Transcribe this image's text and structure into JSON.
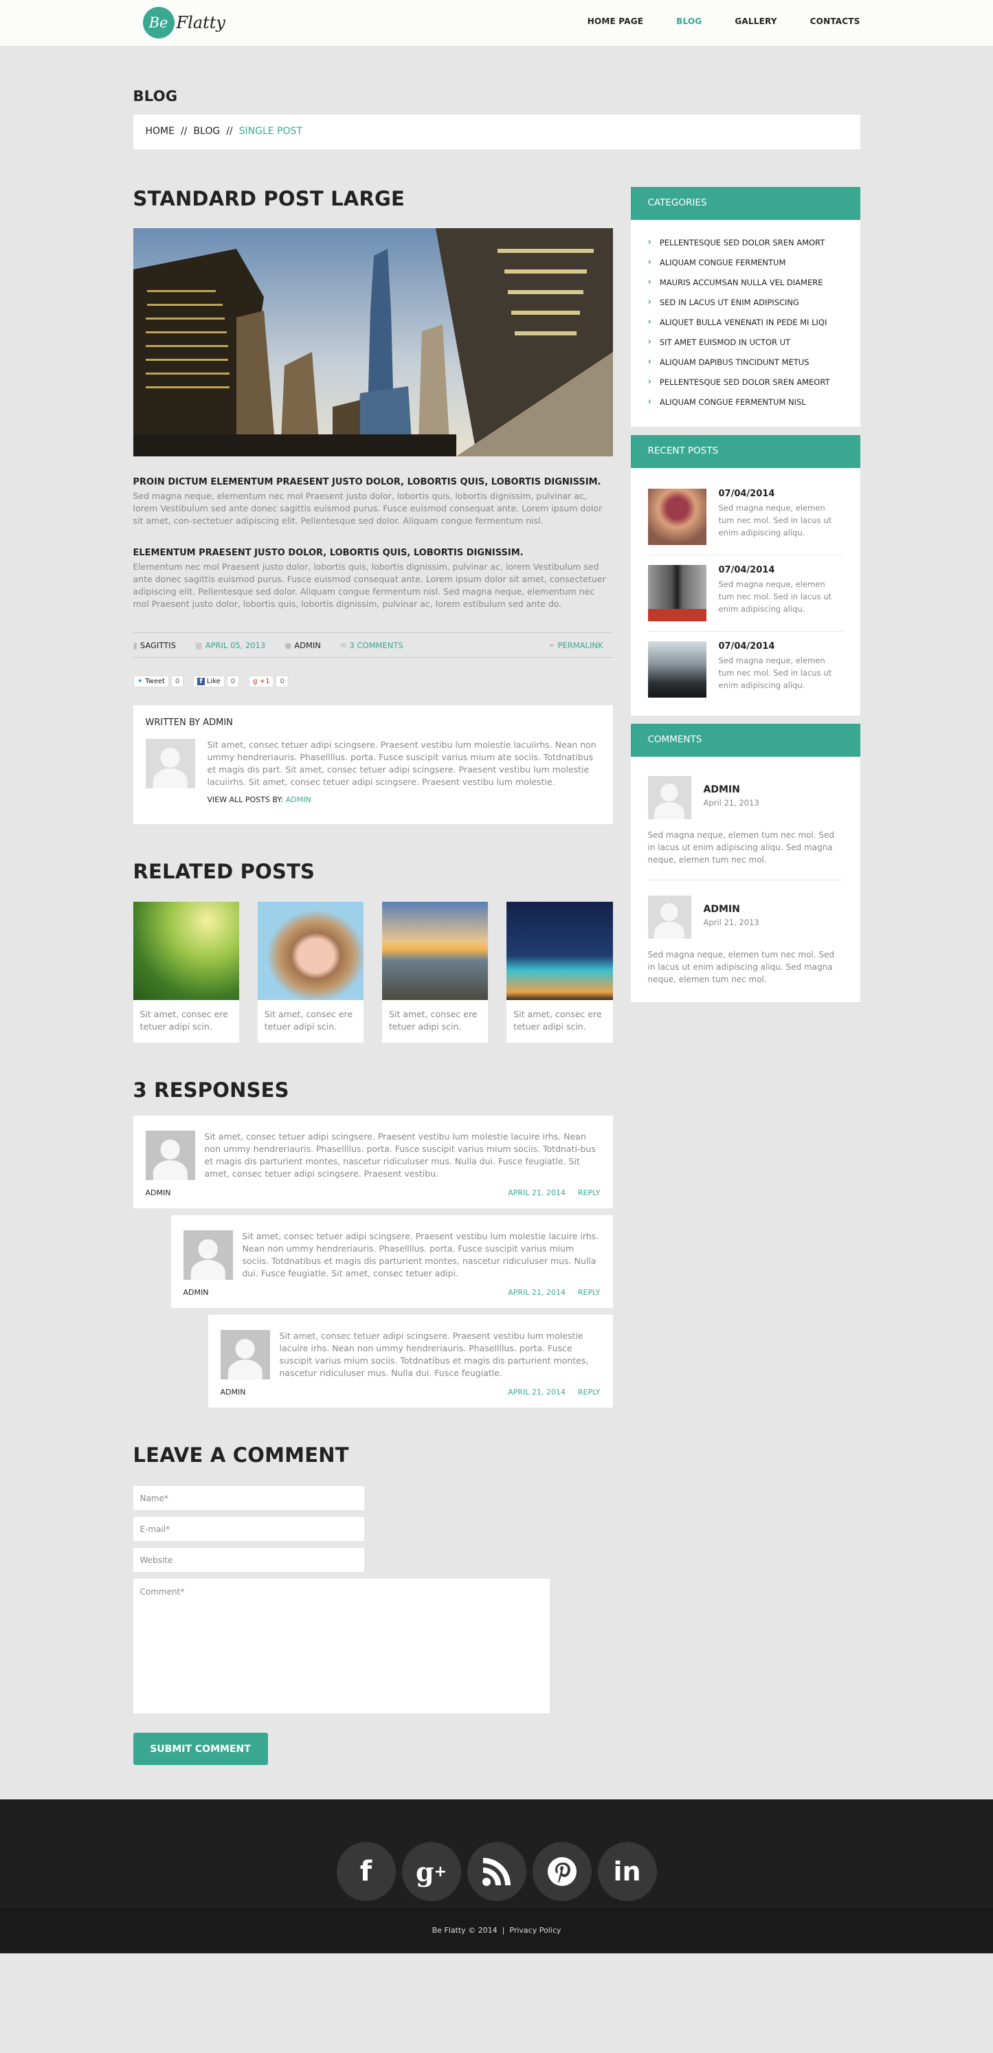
{
  "brand": {
    "logo_mark": "Be",
    "logo_text": "Flatty",
    "accent": "#3aa891"
  },
  "nav": [
    {
      "label": "HOME PAGE",
      "active": false
    },
    {
      "label": "BLOG",
      "active": true
    },
    {
      "label": "GALLERY",
      "active": false
    },
    {
      "label": "CONTACTS",
      "active": false
    }
  ],
  "page_title": "BLOG",
  "breadcrumb": {
    "items": [
      "HOME",
      "BLOG"
    ],
    "current": "SINGLE POST",
    "separator": "//"
  },
  "post": {
    "title": "STANDARD POST LARGE",
    "sections": [
      {
        "heading": "PROIN DICTUM ELEMENTUM PRAESENT JUSTO DOLOR, LOBORTIS QUIS, LOBORTIS DIGNISSIM.",
        "body": "Sed magna neque, elementum nec mol Praesent justo dolor, lobortis quis, lobortis dignissim, pulvinar ac, lorem Vestibulum sed ante donec sagittis euismod purus. Fusce euismod consequat ante. Lorem ipsum dolor sit amet, con-sectetuer adipiscing elit. Pellentesque sed dolor. Aliquam congue fermentum nisl."
      },
      {
        "heading": "ELEMENTUM PRAESENT JUSTO DOLOR, LOBORTIS QUIS, LOBORTIS DIGNISSIM.",
        "body": "Elementum nec mol Praesent justo dolor, lobortis quis, lobortis dignissim, pulvinar ac, lorem Vestibulum sed ante donec sagittis euismod purus. Fusce euismod consequat ante. Lorem ipsum dolor sit amet, consectetuer adipiscing elit. Pellentesque sed dolor. Aliquam congue fermentum nisl. Sed magna neque, elementum nec mol Praesent justo dolor, lobortis quis, lobortis dignissim, pulvinar ac, lorem estibulum sed ante do."
      }
    ],
    "meta": {
      "tag": "SAGITTIS",
      "date": "APRIL 05, 2013",
      "author": "ADMIN",
      "comments": "3 COMMENTS",
      "permalink": "PERMALINK"
    },
    "share": [
      {
        "label": "Tweet",
        "count": "0"
      },
      {
        "label": "Like",
        "count": "0"
      },
      {
        "label": "+1",
        "count": "0"
      }
    ]
  },
  "author_box": {
    "title": "WRITTEN BY ADMIN",
    "bio": "Sit amet, consec tetuer adipi scingsere. Praesent vestibu  lum molestie lacuiirhs. Nean non ummy hendreriauris. Phasellllus. porta. Fusce suscipit varius mium ate sociis. Totdnatibus et magis dis part. Sit amet, consec tetuer adipi scingsere. Praesent vestibu  lum molestie lacuiirhs. Sit amet, consec tetuer adipi scingsere. Praesent vestibu  lum molestie.",
    "view_all_label": "VIEW ALL POSTS BY:",
    "view_all_link": "ADMIN"
  },
  "related": {
    "title": "RELATED POSTS",
    "items": [
      {
        "text": "Sit amet, consec ere tetuer adipi scin.",
        "image": "fern-forest"
      },
      {
        "text": "Sit amet, consec ere tetuer adipi scin.",
        "image": "woman-portrait"
      },
      {
        "text": "Sit amet, consec ere tetuer adipi scin.",
        "image": "sunset-coast"
      },
      {
        "text": "Sit amet, consec ere tetuer adipi scin.",
        "image": "night-skyscrapers"
      }
    ]
  },
  "responses": {
    "title": "3 RESPONSES",
    "items": [
      {
        "author": "ADMIN",
        "date": "APRIL 21, 2014",
        "reply": "REPLY",
        "text": "Sit amet, consec tetuer adipi scingsere. Praesent vestibu  lum molestie lacuire irhs. Nean non ummy hendreriauris. Phasellllus. porta. Fusce suscipit varius mium sociis. Totdnati-bus et magis dis parturient montes, nascetur ridiculuser mus. Nulla dui. Fusce feugiatle. Sit amet, consec tetuer adipi scingsere. Praesent vestibu."
      },
      {
        "author": "ADMIN",
        "date": "APRIL 21, 2014",
        "reply": "REPLY",
        "text": "Sit amet, consec tetuer adipi scingsere. Praesent vestibu  lum molestie lacuire irhs. Nean non ummy hendreriauris. Phasellllus. porta. Fusce suscipit varius mium sociis. Totdnatibus et magis dis parturient montes, nascetur ridiculuser mus. Nulla dui. Fusce feugiatle. Sit amet, consec tetuer adipi."
      },
      {
        "author": "ADMIN",
        "date": "APRIL 21, 2014",
        "reply": "REPLY",
        "text": "Sit amet, consec tetuer adipi scingsere. Praesent vestibu  lum molestie lacuire irhs. Nean non ummy hendreriauris. Phasellllus. porta. Fusce suscipit varius mium sociis. Totdnatibus et magis dis parturient montes, nascetur ridiculuser mus. Nulla dui. Fusce feugiatle."
      }
    ]
  },
  "comment_form": {
    "title": "LEAVE A COMMENT",
    "name_placeholder": "Name*",
    "email_placeholder": "E-mail*",
    "website_placeholder": "Website",
    "comment_placeholder": "Comment*",
    "submit_label": "SUBMIT COMMENT"
  },
  "sidebar": {
    "categories": {
      "title": "CATEGORIES",
      "items": [
        "PELLENTESQUE SED DOLOR SREN AMORT",
        "ALIQUAM CONGUE FERMENTUM",
        "MAURIS ACCUMSAN NULLA VEL DIAMERE",
        "SED IN LACUS UT ENIM ADIPISCING",
        "ALIQUET BULLA VENENATI IN PEDE MI LIQI",
        "SIT AMET EUISMOD IN UCTOR UT",
        "ALIQUAM DAPIBUS TINCIDUNT METUS",
        "PELLENTESQUE SED DOLOR SREN AMEORT",
        "ALIQUAM CONGUE FERMENTUM NISL"
      ]
    },
    "recent_posts": {
      "title": "RECENT POSTS",
      "items": [
        {
          "date": "07/04/2014",
          "text": "Sed magna neque, elemen tum nec mol. Sed in lacus ut enim adipiscing aliqu.",
          "image": "heart-tree"
        },
        {
          "date": "07/04/2014",
          "text": "Sed magna neque, elemen tum nec mol. Sed in lacus ut enim adipiscing aliqu.",
          "image": "shopping-woman"
        },
        {
          "date": "07/04/2014",
          "text": "Sed magna neque, elemen tum nec mol. Sed in lacus ut enim adipiscing aliqu.",
          "image": "city-skyline"
        }
      ]
    },
    "comments": {
      "title": "COMMENTS",
      "items": [
        {
          "name": "ADMIN",
          "date": "April 21, 2013",
          "text": "Sed magna neque, elemen tum nec mol. Sed in lacus ut enim adipiscing aliqu. Sed magna neque, elemen tum nec mol."
        },
        {
          "name": "ADMIN",
          "date": "April 21, 2013",
          "text": "Sed magna neque, elemen tum nec mol. Sed in lacus ut enim adipiscing aliqu. Sed magna neque, elemen tum nec mol."
        }
      ]
    }
  },
  "footer": {
    "social": [
      {
        "icon": "facebook-icon",
        "glyph": "f"
      },
      {
        "icon": "google-plus-icon",
        "glyph": "g+"
      },
      {
        "icon": "rss-icon",
        "glyph": "rss"
      },
      {
        "icon": "pinterest-icon",
        "glyph": "p"
      },
      {
        "icon": "linkedin-icon",
        "glyph": "in"
      }
    ],
    "copyright": "Be Flatty © 2014",
    "separator": "|",
    "privacy": "Privacy Policy"
  }
}
